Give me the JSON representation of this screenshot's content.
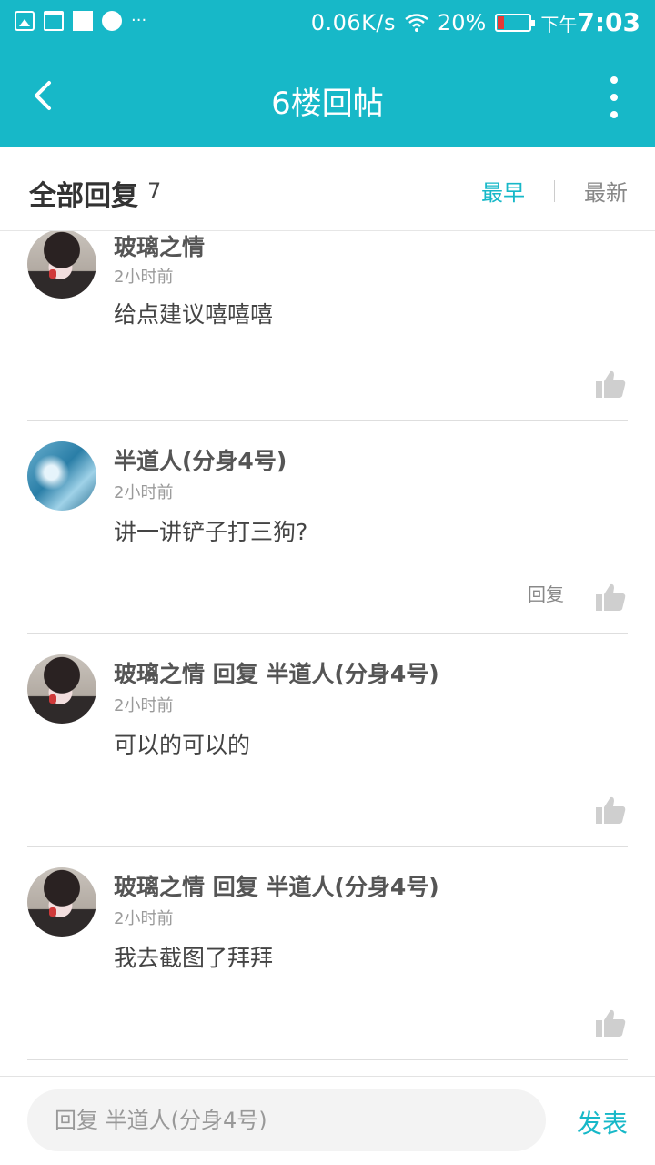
{
  "status_bar": {
    "icons": [
      "gallery-icon",
      "calendar-icon",
      "square-icon",
      "globe-icon"
    ],
    "more": "···",
    "speed": "0.06K/s",
    "battery": "20%",
    "battery_level": 0.2,
    "time_prefix": "下午",
    "time": "7:03"
  },
  "app_bar": {
    "title": "6楼回帖",
    "back_icon": "chevron-left-icon",
    "more_icon": "more-vertical-icon"
  },
  "reply_header": {
    "title": "全部回复",
    "count": "7",
    "sort_early": "最早",
    "sort_new": "最新"
  },
  "comments": [
    {
      "name": "玻璃之情",
      "time": "2小时前",
      "text": "给点建议嘻嘻嘻",
      "reply_label": ""
    },
    {
      "name": "半道人(分身4号)",
      "time": "2小时前",
      "text": "讲一讲铲子打三狗?",
      "reply_label": "回复"
    },
    {
      "name": "玻璃之情 回复 半道人(分身4号)",
      "time": "2小时前",
      "text": "可以的可以的",
      "reply_label": ""
    },
    {
      "name": "玻璃之情 回复 半道人(分身4号)",
      "time": "2小时前",
      "text": "我去截图了拜拜",
      "reply_label": ""
    }
  ],
  "input_bar": {
    "placeholder": "回复 半道人(分身4号)",
    "send_label": "发表"
  },
  "colors": {
    "accent": "#17b8c8",
    "battery_low": "#e53935"
  }
}
